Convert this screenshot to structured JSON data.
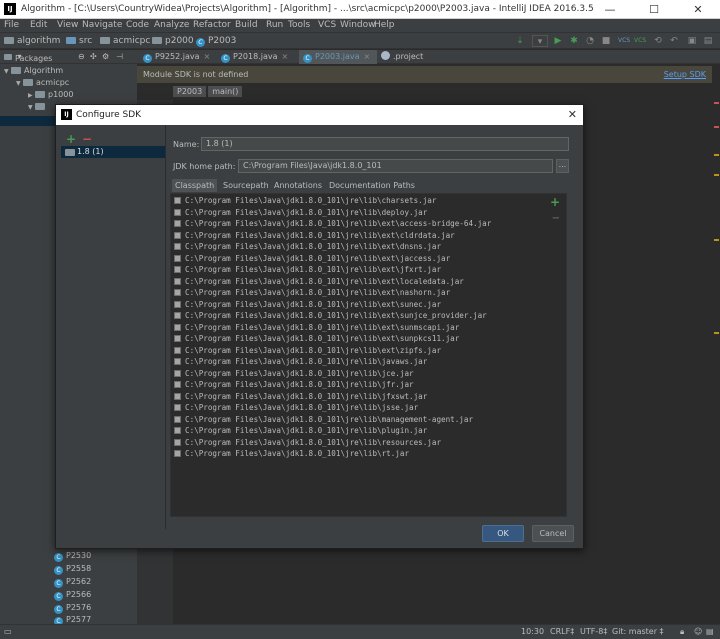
{
  "window": {
    "title": "Algorithm - [C:\\Users\\CountryWidea\\Projects\\Algorithm] - [Algorithm] - ...\\src\\acmicpc\\p2000\\P2003.java - IntelliJ IDEA 2016.3.5",
    "app_icon": "IJ",
    "controls": {
      "minimize": "—",
      "maximize": "☐",
      "close": "✕"
    }
  },
  "menu": [
    "File",
    "Edit",
    "View",
    "Navigate",
    "Code",
    "Analyze",
    "Refactor",
    "Build",
    "Run",
    "Tools",
    "VCS",
    "Window",
    "Help"
  ],
  "navbar": {
    "crumbs": [
      "algorithm",
      "src",
      "acmicpc",
      "p2000",
      "P2003"
    ],
    "vcs_labels": [
      "VCS",
      "VCS"
    ]
  },
  "project_panel": {
    "header": "Packages",
    "tree": [
      {
        "label": "Algorithm",
        "level": 0
      },
      {
        "label": "acmicpc",
        "level": 1
      },
      {
        "label": "p1000",
        "level": 2
      },
      {
        "label": "",
        "level": 2
      }
    ],
    "bottom_items": [
      "P2530",
      "P2558",
      "P2562",
      "P2566",
      "P2576",
      "P2577"
    ]
  },
  "editor": {
    "tabs": [
      {
        "label": "P9252.java",
        "active": false
      },
      {
        "label": "P2018.java",
        "active": false
      },
      {
        "label": "P2003.java",
        "active": true
      },
      {
        "label": ".project",
        "active": false
      }
    ],
    "notification": {
      "message": "Module SDK is not defined",
      "action": "Setup SDK"
    },
    "breadcrumb": [
      "P2003",
      "main()"
    ]
  },
  "dialog": {
    "title": "Configure SDK",
    "close": "✕",
    "add_symbol": "+",
    "remove_symbol": "−",
    "sdk_list": [
      "1.8 (1)"
    ],
    "name_label": "Name:",
    "name_value": "1.8 (1)",
    "home_label": "JDK home path:",
    "home_value": "C:\\Program Files\\Java\\jdk1.8.0_101",
    "browse": "...",
    "tabs": [
      "Classpath",
      "Sourcepath",
      "Annotations",
      "Documentation Paths"
    ],
    "list_add": "+",
    "classpath": [
      "C:\\Program Files\\Java\\jdk1.8.0_101\\jre\\lib\\charsets.jar",
      "C:\\Program Files\\Java\\jdk1.8.0_101\\jre\\lib\\deploy.jar",
      "C:\\Program Files\\Java\\jdk1.8.0_101\\jre\\lib\\ext\\access-bridge-64.jar",
      "C:\\Program Files\\Java\\jdk1.8.0_101\\jre\\lib\\ext\\cldrdata.jar",
      "C:\\Program Files\\Java\\jdk1.8.0_101\\jre\\lib\\ext\\dnsns.jar",
      "C:\\Program Files\\Java\\jdk1.8.0_101\\jre\\lib\\ext\\jaccess.jar",
      "C:\\Program Files\\Java\\jdk1.8.0_101\\jre\\lib\\ext\\jfxrt.jar",
      "C:\\Program Files\\Java\\jdk1.8.0_101\\jre\\lib\\ext\\localedata.jar",
      "C:\\Program Files\\Java\\jdk1.8.0_101\\jre\\lib\\ext\\nashorn.jar",
      "C:\\Program Files\\Java\\jdk1.8.0_101\\jre\\lib\\ext\\sunec.jar",
      "C:\\Program Files\\Java\\jdk1.8.0_101\\jre\\lib\\ext\\sunjce_provider.jar",
      "C:\\Program Files\\Java\\jdk1.8.0_101\\jre\\lib\\ext\\sunmscapi.jar",
      "C:\\Program Files\\Java\\jdk1.8.0_101\\jre\\lib\\ext\\sunpkcs11.jar",
      "C:\\Program Files\\Java\\jdk1.8.0_101\\jre\\lib\\ext\\zipfs.jar",
      "C:\\Program Files\\Java\\jdk1.8.0_101\\jre\\lib\\javaws.jar",
      "C:\\Program Files\\Java\\jdk1.8.0_101\\jre\\lib\\jce.jar",
      "C:\\Program Files\\Java\\jdk1.8.0_101\\jre\\lib\\jfr.jar",
      "C:\\Program Files\\Java\\jdk1.8.0_101\\jre\\lib\\jfxswt.jar",
      "C:\\Program Files\\Java\\jdk1.8.0_101\\jre\\lib\\jsse.jar",
      "C:\\Program Files\\Java\\jdk1.8.0_101\\jre\\lib\\management-agent.jar",
      "C:\\Program Files\\Java\\jdk1.8.0_101\\jre\\lib\\plugin.jar",
      "C:\\Program Files\\Java\\jdk1.8.0_101\\jre\\lib\\resources.jar",
      "C:\\Program Files\\Java\\jdk1.8.0_101\\jre\\lib\\rt.jar"
    ],
    "ok": "OK",
    "cancel": "Cancel"
  },
  "status": {
    "position": "10:30",
    "line_sep": "CRLF‡",
    "encoding": "UTF-8‡",
    "git": "Git: master ‡"
  },
  "colors": {
    "background": "#2b2b2b",
    "panel": "#3c3f41",
    "accent_blue": "#365880",
    "link": "#589df6",
    "add_green": "#499c54",
    "remove_red": "#c75450"
  }
}
